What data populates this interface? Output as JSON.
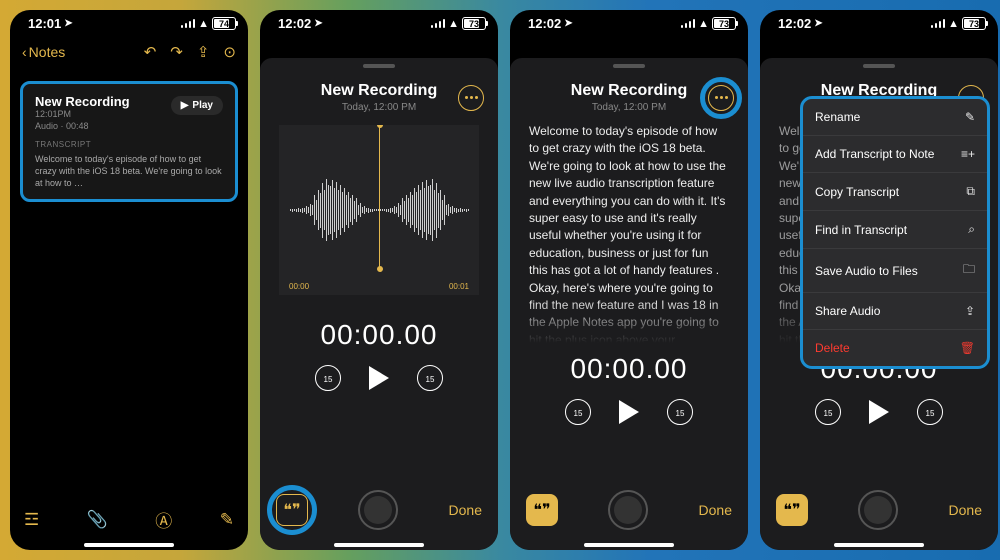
{
  "status": {
    "time": "12:01",
    "time2": "12:02",
    "battery1": "74",
    "battery2": "73"
  },
  "nav": {
    "back": "Notes"
  },
  "card": {
    "title": "New Recording",
    "time": "12:01PM",
    "meta": "Audio · 00:48",
    "play": "Play",
    "tr_label": "TRANSCRIPT",
    "tr_body": "Welcome to today's episode of how to get crazy with the iOS 18 beta. We're going to look at how to …"
  },
  "sheet": {
    "title": "New Recording",
    "sub": "Today, 12:00 PM",
    "tick_left": "00:00",
    "tick_right": "00:01",
    "timer": "00:00.00",
    "skip": "15",
    "done": "Done"
  },
  "transcript": "Welcome to today's episode of how to get crazy with the iOS 18 beta. We're going to look at how to use the new live audio transcription feature and everything you can do  with it. It's super easy to use and it's really useful whether you're using it for education, business or just for fun this has got a lot of handy features . Okay, here's where you're going to find the new feature and I was 18 in the Apple Notes app you're going to hit the plus icon above your",
  "transcript_short": "Welcome to today's episode of how to get crazy with the iOS 18 beta. We're going to look at how to use the new live audio transcription feature and everything you can do  with it. It's super easy to use and it's really useful whether you're using it for education, business or just for fun this has got a lot of handy features . Okay, here's where you're going to find the new feature and I was 18 in the Apple Notes app you're going to hit the plus icon above your",
  "menu": {
    "rename": "Rename",
    "add": "Add Transcript to Note",
    "copy": "Copy Transcript",
    "find": "Find in Transcript",
    "save": "Save Audio to Files",
    "share": "Share Audio",
    "delete": "Delete"
  }
}
